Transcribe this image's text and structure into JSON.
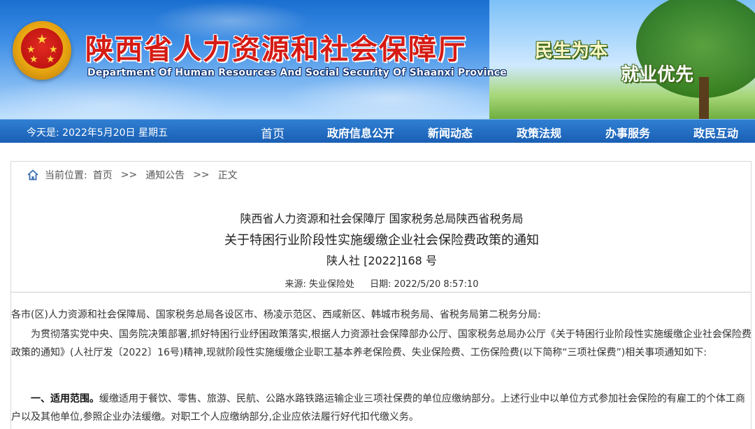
{
  "header": {
    "site_title": "陕西省人力资源和社会保障厅",
    "site_subtitle": "Department Of Human Resources And Social Security Of Shaanxi Province",
    "slogan_1": "民生为本",
    "slogan_2": "就业优先"
  },
  "navbar": {
    "date_label": "今天是:  2022年5月20日 星期五",
    "items": [
      "首页",
      "政府信息公开",
      "新闻动态",
      "政策法规",
      "办事服务",
      "政民互动"
    ]
  },
  "breadcrumb": {
    "prefix": "当前位置:",
    "items": [
      "首页",
      "通知公告",
      "正文"
    ],
    "separator": ">>"
  },
  "document": {
    "title_line1": "陕西省人力资源和社会保障厅 国家税务总局陕西省税务局",
    "title_line2": "关于特困行业阶段性实施缓缴企业社会保险费政策的通知",
    "doc_number": "陕人社 [2022]168 号",
    "source_label": "来源: 失业保险处",
    "date_label": "日期: 2022/5/20 8:57:10",
    "addressee": "各市(区)人力资源和社会保障局、国家税务总局各设区市、杨凌示范区、西咸新区、韩城市税务局、省税务局第二税务分局:",
    "intro_paragraph": "为贯彻落实党中央、国务院决策部署,抓好特困行业纾困政策落实,根据人力资源社会保障部办公厅、国家税务总局办公厅《关于特困行业阶段性实施缓缴企业社会保险费政策的通知》(人社厅发〔2022〕16号)精神,现就阶段性实施缓缴企业职工基本养老保险费、失业保险费、工伤保险费(以下简称“三项社保费”)相关事项通知如下:",
    "section1_heading": "一、适用范围。",
    "section1_text": "缓缴适用于餐饮、零售、旅游、民航、公路水路铁路运输企业三项社保费的单位应缴纳部分。上述行业中以单位方式参加社会保险的有雇工的个体工商户以及其他单位,参照企业办法缓缴。对职工个人应缴纳部分,企业应依法履行好代扣代缴义务。"
  },
  "colors": {
    "nav_bar": "#1a5fb4",
    "title_red": "#d51b14",
    "text": "#333333"
  }
}
